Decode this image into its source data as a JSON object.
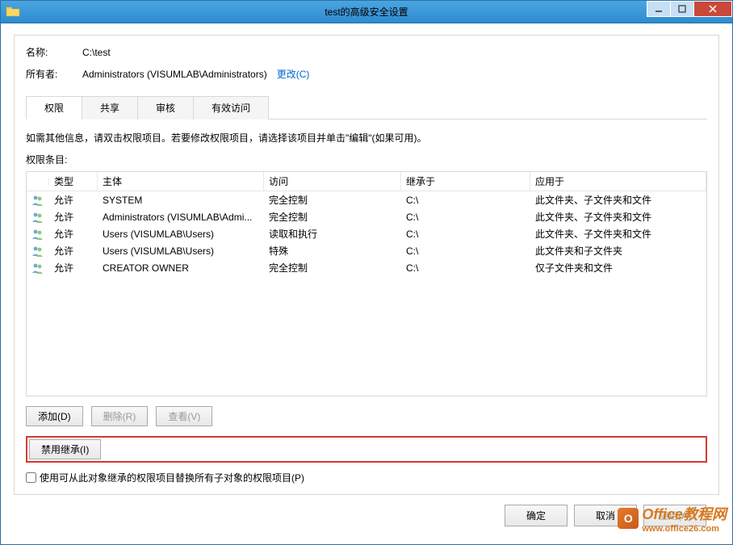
{
  "window": {
    "title": "test的高级安全设置"
  },
  "info": {
    "name_label": "名称:",
    "name_value": "C:\\test",
    "owner_label": "所有者:",
    "owner_value": "Administrators (VISUMLAB\\Administrators)",
    "change_link": "更改(C)"
  },
  "tabs": {
    "perm": "权限",
    "share": "共享",
    "audit": "审核",
    "effective": "有效访问"
  },
  "hint": "如需其他信息，请双击权限项目。若要修改权限项目，请选择该项目并单击\"编辑\"(如果可用)。",
  "list_label": "权限条目:",
  "columns": {
    "type": "类型",
    "principal": "主体",
    "access": "访问",
    "inherited_from": "继承于",
    "applies_to": "应用于"
  },
  "rows": [
    {
      "type": "允许",
      "principal": "SYSTEM",
      "access": "完全控制",
      "inherited": "C:\\",
      "applies": "此文件夹、子文件夹和文件"
    },
    {
      "type": "允许",
      "principal": "Administrators (VISUMLAB\\Admi...",
      "access": "完全控制",
      "inherited": "C:\\",
      "applies": "此文件夹、子文件夹和文件"
    },
    {
      "type": "允许",
      "principal": "Users (VISUMLAB\\Users)",
      "access": "读取和执行",
      "inherited": "C:\\",
      "applies": "此文件夹、子文件夹和文件"
    },
    {
      "type": "允许",
      "principal": "Users (VISUMLAB\\Users)",
      "access": "特殊",
      "inherited": "C:\\",
      "applies": "此文件夹和子文件夹"
    },
    {
      "type": "允许",
      "principal": "CREATOR OWNER",
      "access": "完全控制",
      "inherited": "C:\\",
      "applies": "仅子文件夹和文件"
    }
  ],
  "buttons": {
    "add": "添加(D)",
    "remove": "删除(R)",
    "view": "查看(V)",
    "disable_inherit": "禁用继承(I)",
    "ok": "确定",
    "cancel": "取消",
    "apply": "应用(A)"
  },
  "checkbox_label": "使用可从此对象继承的权限项目替换所有子对象的权限项目(P)",
  "watermark": {
    "main": "Office教程网",
    "sub": "www.office26.com"
  }
}
